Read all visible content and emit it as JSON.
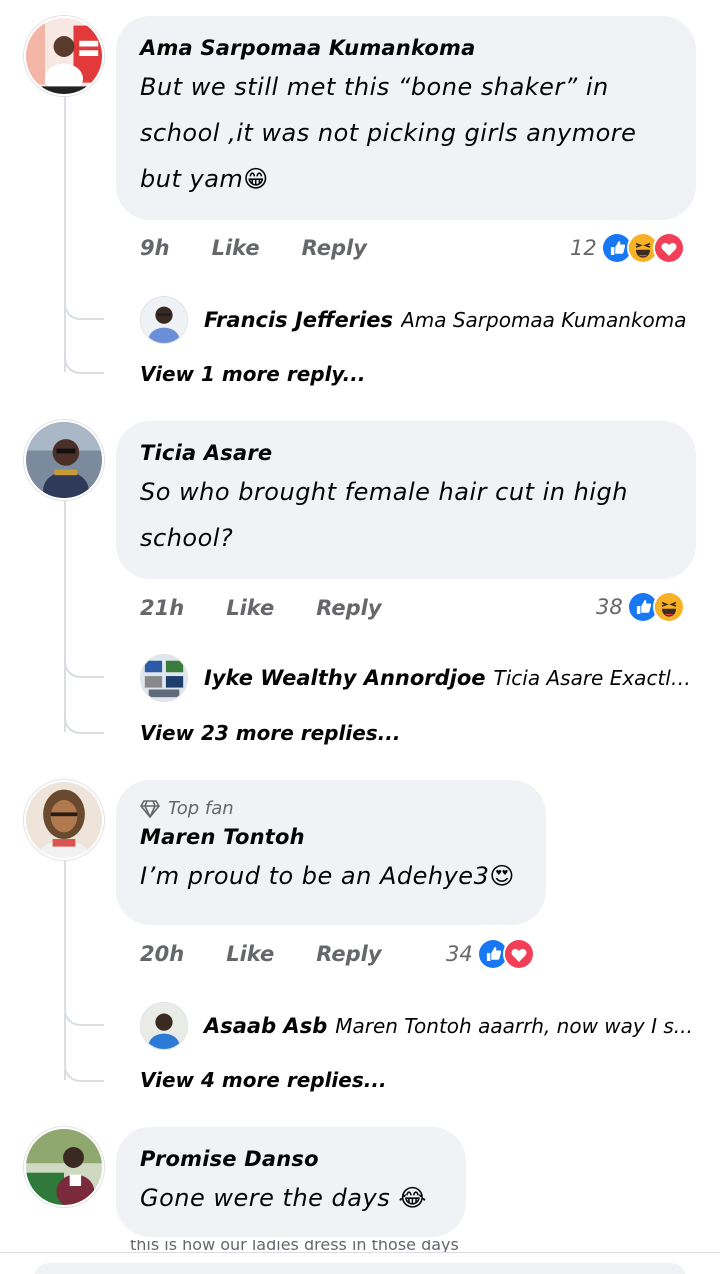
{
  "comments": [
    {
      "author": "Ama Sarpomaa Kumankoma",
      "text": "But we still met this “bone shaker” in school ,it was not picking girls anymore but yam😁",
      "time": "9h",
      "like_label": "Like",
      "reply_label": "Reply",
      "reaction_count": "12",
      "reactions": [
        "like-icon",
        "haha-icon",
        "love-icon"
      ],
      "reply_preview": {
        "name": "Francis Jefferies",
        "text": "Ama Sarpomaa Kumankoma"
      },
      "view_more": "View 1 more reply..."
    },
    {
      "author": "Ticia Asare",
      "text": "So who brought female hair cut in high school?",
      "time": "21h",
      "like_label": "Like",
      "reply_label": "Reply",
      "reaction_count": "38",
      "reactions": [
        "like-icon",
        "haha-icon"
      ],
      "reply_preview": {
        "name": "Iyke Wealthy Annordjoe",
        "text": "Ticia Asare Exactly ..."
      },
      "view_more": "View 23 more replies..."
    },
    {
      "badge": "Top fan",
      "author": "Maren Tontoh",
      "text": "I’m proud to be an Adehye3😍",
      "time": "20h",
      "like_label": "Like",
      "reply_label": "Reply",
      "reaction_count": "34",
      "reactions": [
        "like-icon",
        "love-icon"
      ],
      "reply_preview": {
        "name": "Asaab Asb",
        "text": "Maren Tontoh aaarrh,  now way I s..."
      },
      "view_more": "View 4 more replies..."
    },
    {
      "author": "Promise Danso",
      "text": "Gone were the days 😂"
    }
  ],
  "cut_off_text": "this is how our ladies dress in those days",
  "colors": {
    "bubble": "#f0f2f5",
    "meta": "#65676b",
    "like": "#1877f2",
    "love": "#f33e58",
    "haha": "#f7b125"
  }
}
